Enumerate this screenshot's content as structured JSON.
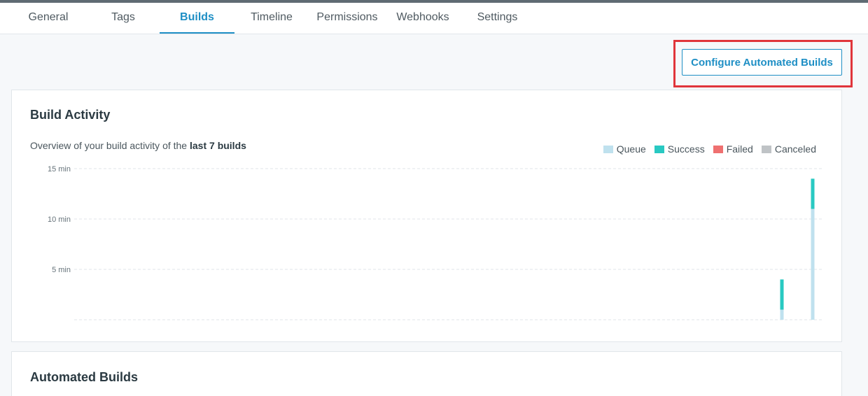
{
  "tabs": [
    {
      "label": "General",
      "active": false
    },
    {
      "label": "Tags",
      "active": false
    },
    {
      "label": "Builds",
      "active": true
    },
    {
      "label": "Timeline",
      "active": false
    },
    {
      "label": "Permissions",
      "active": false
    },
    {
      "label": "Webhooks",
      "active": false
    },
    {
      "label": "Settings",
      "active": false
    }
  ],
  "toolbar": {
    "configure_label": "Configure Automated Builds"
  },
  "build_activity": {
    "title": "Build Activity",
    "subtitle_prefix": "Overview of your build activity of the ",
    "subtitle_bold": "last 7 builds"
  },
  "automated_builds": {
    "title": "Automated Builds"
  },
  "colors": {
    "accent": "#1f8fc5",
    "highlight": "#e0353b",
    "queue": "#bfe1ee",
    "success": "#29c9c2",
    "failed": "#ef7070",
    "canceled": "#bfc3c6"
  },
  "chart_data": {
    "type": "bar",
    "stacked": true,
    "ylim": [
      0,
      15
    ],
    "yticks": [
      {
        "value": 15,
        "label": "15 min"
      },
      {
        "value": 10,
        "label": "10 min"
      },
      {
        "value": 5,
        "label": "5 min"
      }
    ],
    "legend": [
      {
        "name": "Queue",
        "color": "#bfe1ee"
      },
      {
        "name": "Success",
        "color": "#29c9c2"
      },
      {
        "name": "Failed",
        "color": "#ef7070"
      },
      {
        "name": "Canceled",
        "color": "#bfc3c6"
      }
    ],
    "legend_position": "top-right",
    "grid": true,
    "builds": [
      {
        "queue": 0,
        "success": 0,
        "failed": 0,
        "canceled": 0
      },
      {
        "queue": 0,
        "success": 0,
        "failed": 0,
        "canceled": 0
      },
      {
        "queue": 0,
        "success": 0,
        "failed": 0,
        "canceled": 0
      },
      {
        "queue": 0,
        "success": 0,
        "failed": 0,
        "canceled": 0
      },
      {
        "queue": 0,
        "success": 0,
        "failed": 0,
        "canceled": 0
      },
      {
        "queue": 1,
        "success": 3,
        "failed": 0,
        "canceled": 0
      },
      {
        "queue": 11,
        "success": 3,
        "failed": 0,
        "canceled": 0
      }
    ]
  }
}
